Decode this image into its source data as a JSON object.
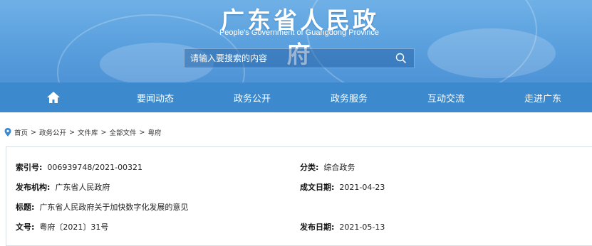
{
  "header": {
    "title": "广东省人民政府",
    "subtitle": "People's Government of Guangdong Province",
    "search_placeholder": "请输入要搜索的内容"
  },
  "nav": {
    "home_icon": "home-icon",
    "items": [
      "要闻动态",
      "政务公开",
      "政务服务",
      "互动交流",
      "走进广东"
    ]
  },
  "breadcrumb": [
    "首页",
    "政务公开",
    "文件库",
    "全部文件",
    "粤府"
  ],
  "info": {
    "index_label": "索引号:",
    "index_value": "006939748/2021-00321",
    "category_label": "分类:",
    "category_value": "综合政务",
    "publisher_label": "发布机构:",
    "publisher_value": "广东省人民政府",
    "created_label": "成文日期:",
    "created_value": "2021-04-23",
    "title_label": "标题:",
    "title_value": "广东省人民政府关于加快数字化发展的意见",
    "docno_label": "文号:",
    "docno_value": "粤府〔2021〕31号",
    "published_label": "发布日期:",
    "published_value": "2021-05-13"
  },
  "colors": {
    "banner": "#5aa0de",
    "nav": "#3c89cd",
    "pin": "#3c89cd"
  }
}
